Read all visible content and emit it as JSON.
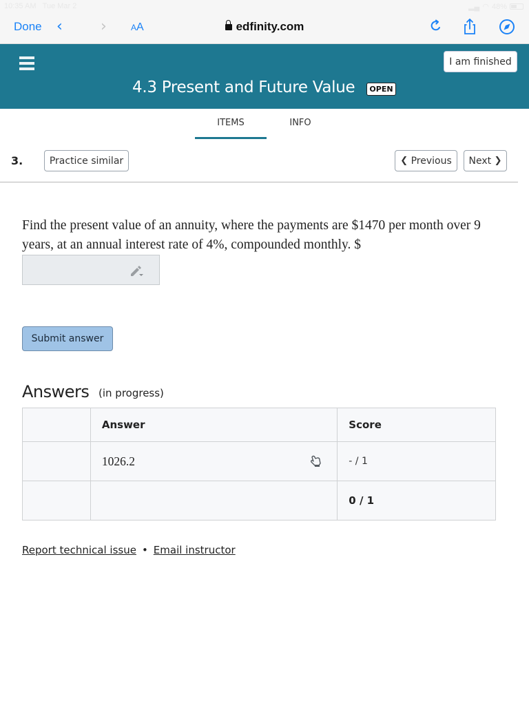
{
  "status_bar": {
    "time": "10:35 AM",
    "date": "Tue Mar 2",
    "battery": "48%"
  },
  "browser": {
    "done_label": "Done",
    "back_icon": "chevron-left",
    "forward_icon": "chevron-right",
    "text_size_small": "A",
    "text_size_big": "A",
    "url": "edfinity.com",
    "reload_icon": "reload",
    "share_icon": "share",
    "compass_icon": "compass",
    "accent_color": "#1a82f7"
  },
  "header": {
    "menu_icon": "hamburger",
    "finish_label": "I am finished",
    "title": "4.3 Present and Future Value",
    "badge": "OPEN",
    "background_color": "#1e7891"
  },
  "tabs": [
    {
      "label": "ITEMS",
      "active": true
    },
    {
      "label": "INFO",
      "active": false
    }
  ],
  "question_bar": {
    "number": "3.",
    "practice_label": "Practice similar",
    "previous_label": "Previous",
    "next_label": "Next"
  },
  "question": {
    "text": "Find the present value of an annuity, where the payments are $1470 per month over 9 years, at an annual interest rate of 4%, compounded monthly. $",
    "input_value": "",
    "submit_label": "Submit answer"
  },
  "answers": {
    "title": "Answers",
    "status": "(in progress)",
    "columns": [
      "",
      "Answer",
      "Score"
    ],
    "rows": [
      {
        "attempt": "",
        "answer": "1026.2",
        "score": "- / 1"
      }
    ],
    "total": {
      "attempt": "",
      "answer": "",
      "score": "0 / 1"
    }
  },
  "footer": {
    "report_label": "Report technical issue",
    "separator": "•",
    "email_label": "Email instructor"
  }
}
